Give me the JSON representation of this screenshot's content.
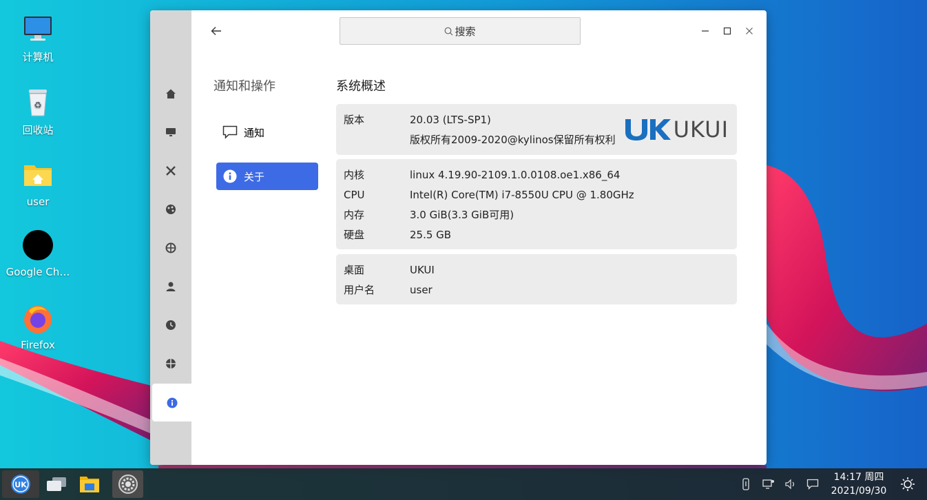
{
  "desktop": {
    "icons": [
      {
        "label": "计算机",
        "icon": "computer-icon"
      },
      {
        "label": "回收站",
        "icon": "trash-icon"
      },
      {
        "label": "user",
        "icon": "home-folder-icon"
      },
      {
        "label": "Google Ch…",
        "icon": "chrome-icon"
      },
      {
        "label": "Firefox",
        "icon": "firefox-icon"
      }
    ]
  },
  "window": {
    "search_placeholder": "搜索",
    "sidebar_icons": [
      "home-icon",
      "display-icon",
      "devices-icon",
      "personalize-icon",
      "network-icon",
      "account-icon",
      "time-icon",
      "update-icon",
      "info-icon"
    ],
    "category_title": "通知和操作",
    "nav_items": [
      {
        "label": "通知",
        "icon": "notification-icon"
      },
      {
        "label": "关于",
        "icon": "info-icon",
        "active": true
      }
    ],
    "content_title": "系统概述",
    "logo_text": "UKUI",
    "version_card": {
      "version_key": "版本",
      "version_value": "20.03 (LTS-SP1)",
      "copyright": "版权所有2009-2020@kylinos保留所有权利"
    },
    "hardware": [
      {
        "key": "内核",
        "value": "linux 4.19.90-2109.1.0.0108.oe1.x86_64"
      },
      {
        "key": "CPU",
        "value": "Intel(R) Core(TM) i7-8550U CPU @ 1.80GHz"
      },
      {
        "key": "内存",
        "value": "3.0 GiB(3.3 GiB可用)"
      },
      {
        "key": "硬盘",
        "value": "25.5 GB"
      }
    ],
    "desktop_info": [
      {
        "key": "桌面",
        "value": "UKUI"
      },
      {
        "key": "用户名",
        "value": "user"
      }
    ]
  },
  "taskbar": {
    "time": "14:17 周四",
    "date": "2021/09/30"
  },
  "colors": {
    "accent": "#3d6be5",
    "logo_blue": "#1a6fc0",
    "sidebar_bg": "#d6d6d6",
    "card_bg": "#ececec"
  }
}
